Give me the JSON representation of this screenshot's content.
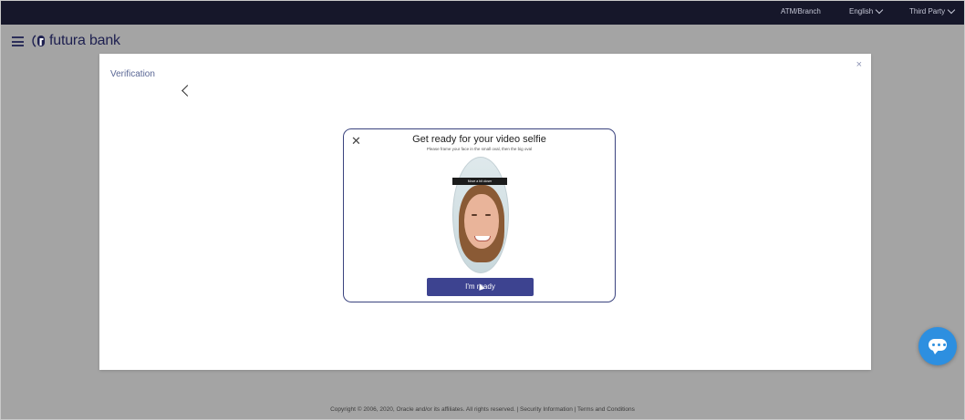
{
  "topbar": {
    "atm_branch": "ATM/Branch",
    "language": "English",
    "third_party": "Third Party"
  },
  "header": {
    "logo_text": "futura bank",
    "icons": {
      "menu": "hamburger-menu-icon"
    }
  },
  "panel": {
    "title": "Verification",
    "close": "×"
  },
  "modal": {
    "close": "✕",
    "title": "Get ready for your video selfie",
    "subtitle": "Please frame your face in the small oval, then the big oval",
    "tooltip": "Move a bit closer",
    "ready_button": "I'm ready"
  },
  "footer": {
    "copyright": "Copyright © 2006, 2020, Oracle and/or its affiliates. All rights reserved. | Security Information | Terms and Conditions"
  },
  "colors": {
    "topbar": "#16172a",
    "overlay": "#a4a4a4",
    "accent": "#3d4390",
    "chat": "#2d8fe0"
  }
}
